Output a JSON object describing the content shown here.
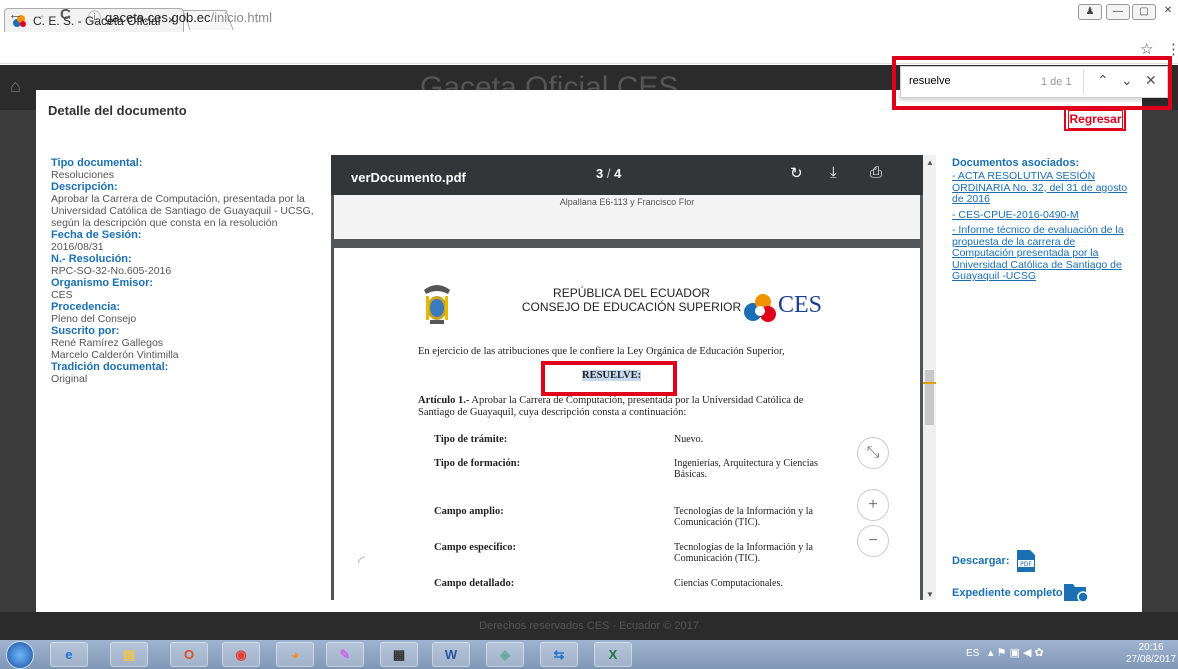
{
  "browser": {
    "tab_title": "C. E. S. - Gaceta Oficial",
    "tab_close": "×",
    "url_host": "gaceta.ces.gob.ec",
    "url_path": "/inicio.html",
    "find_query": "resuelve",
    "find_count": "1 de 1",
    "back": "←",
    "forward": "→",
    "reload": "C",
    "star": "☆",
    "menu": "⋮"
  },
  "page": {
    "header_title": "Gaceta Oficial CES",
    "footer": "Derechos reservados CES - Ecuador © 2017"
  },
  "modal": {
    "title": "Detalle del documento",
    "back_button": "Regresar",
    "fields": [
      {
        "label": "Tipo documental:",
        "value": "Resoluciones"
      },
      {
        "label": "Descripción:",
        "value": "Aprobar la Carrera de Computación, presentada por la Universidad Católica de Santiago de Guayaquil - UCSG, según la descripción que consta en la resolución"
      },
      {
        "label": "Fecha de Sesión:",
        "value": "2016/08/31"
      },
      {
        "label": "N.- Resolución:",
        "value": "RPC-SO-32-No.605-2016"
      },
      {
        "label": "Organismo Emisor:",
        "value": "CES"
      },
      {
        "label": "Procedencia:",
        "value": "Pleno del Consejo"
      },
      {
        "label": "Suscrito por:",
        "value": "René Ramírez Gallegos\nMarcelo Calderón Vintimilla"
      },
      {
        "label": "Tradición documental:",
        "value": "Original"
      }
    ],
    "associated_title": "Documentos asociados:",
    "associated": [
      "- ACTA RESOLUTIVA SESIÓN ORDINARIA No. 32, del 31 de agosto de 2016",
      "- CES-CPUE-2016-0490-M",
      "- Informe técnico de evaluación de la propuesta de la carrera de Computación presentada por la Universidad Católica de Santiago de Guayaquil -UCSG"
    ],
    "download_label": "Descargar:",
    "full_file_label": "Expediente completo"
  },
  "pdf": {
    "filename": "verDocumento.pdf",
    "page": "3",
    "total": "4",
    "prev_page_text": "Alpallana E6-113 y Francisco Flor",
    "heading1": "REPÚBLICA DEL ECUADOR",
    "heading2": "CONSEJO DE EDUCACIÓN SUPERIOR",
    "ces_logo": "CES",
    "intro": "En ejercicio de las atribuciones que le confiere la Ley Orgánica de Educación Superior,",
    "resuelve": "RESUELVE:",
    "article_title": "Artículo 1.-",
    "article_text": " Aprobar la Carrera de Computación, presentada por la Universidad Católica de Santiago de Guayaquil, cuya descripción consta a continuación:",
    "rows": [
      {
        "k": "Tipo de trámite:",
        "v": "Nuevo."
      },
      {
        "k": "Tipo de formación:",
        "v": "Ingenierías, Arquitectura y Ciencias Básicas."
      },
      {
        "k": "Campo amplio:",
        "v": "Tecnologías de la Información y la Comunicación (TIC)."
      },
      {
        "k": "Campo específico:",
        "v": "Tecnologías de la Información y la Comunicación (TIC)."
      },
      {
        "k": "Campo detallado:",
        "v": "Ciencias Computacionales."
      }
    ]
  },
  "taskbar": {
    "lang": "ES",
    "time": "20:16",
    "date": "27/08/2017"
  },
  "colors": {
    "accent": "#1b6fb3",
    "highlight": "#e0001b"
  }
}
